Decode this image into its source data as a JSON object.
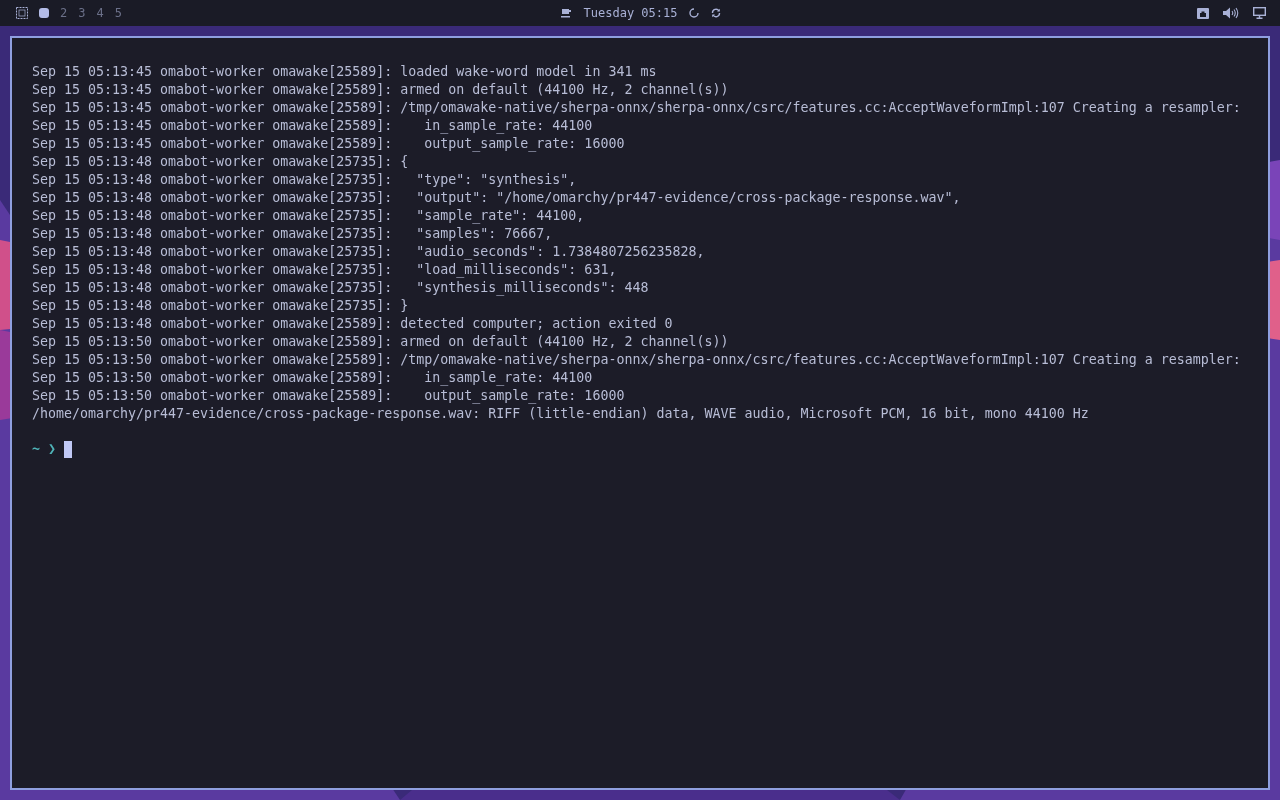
{
  "top_bar": {
    "workspaces": [
      {
        "selected": true
      },
      {
        "label": "2",
        "selected": false
      },
      {
        "label": "3",
        "selected": false
      },
      {
        "label": "4",
        "selected": false
      },
      {
        "label": "5",
        "selected": false
      }
    ],
    "clock": "Tuesday 05:15"
  },
  "terminal": {
    "lines": [
      "Sep 15 05:13:45 omabot-worker omawake[25589]: loaded wake-word model in 341 ms",
      "Sep 15 05:13:45 omabot-worker omawake[25589]: armed on default (44100 Hz, 2 channel(s))",
      "Sep 15 05:13:45 omabot-worker omawake[25589]: /tmp/omawake-native/sherpa-onnx/sherpa-onnx/csrc/features.cc:AcceptWaveformImpl:107 Creating a resampler:",
      "Sep 15 05:13:45 omabot-worker omawake[25589]:    in_sample_rate: 44100",
      "Sep 15 05:13:45 omabot-worker omawake[25589]:    output_sample_rate: 16000",
      "Sep 15 05:13:48 omabot-worker omawake[25735]: {",
      "Sep 15 05:13:48 omabot-worker omawake[25735]:   \"type\": \"synthesis\",",
      "Sep 15 05:13:48 omabot-worker omawake[25735]:   \"output\": \"/home/omarchy/pr447-evidence/cross-package-response.wav\",",
      "Sep 15 05:13:48 omabot-worker omawake[25735]:   \"sample_rate\": 44100,",
      "Sep 15 05:13:48 omabot-worker omawake[25735]:   \"samples\": 76667,",
      "Sep 15 05:13:48 omabot-worker omawake[25735]:   \"audio_seconds\": 1.7384807256235828,",
      "Sep 15 05:13:48 omabot-worker omawake[25735]:   \"load_milliseconds\": 631,",
      "Sep 15 05:13:48 omabot-worker omawake[25735]:   \"synthesis_milliseconds\": 448",
      "Sep 15 05:13:48 omabot-worker omawake[25735]: }",
      "Sep 15 05:13:48 omabot-worker omawake[25589]: detected computer; action exited 0",
      "Sep 15 05:13:50 omabot-worker omawake[25589]: armed on default (44100 Hz, 2 channel(s))",
      "Sep 15 05:13:50 omabot-worker omawake[25589]: /tmp/omawake-native/sherpa-onnx/sherpa-onnx/csrc/features.cc:AcceptWaveformImpl:107 Creating a resampler:",
      "Sep 15 05:13:50 omabot-worker omawake[25589]:    in_sample_rate: 44100",
      "Sep 15 05:13:50 omabot-worker omawake[25589]:    output_sample_rate: 16000",
      "/home/omarchy/pr447-evidence/cross-package-response.wav: RIFF (little-endian) data, WAVE audio, Microsoft PCM, 16 bit, mono 44100 Hz"
    ],
    "prompt": "~ ❯"
  }
}
